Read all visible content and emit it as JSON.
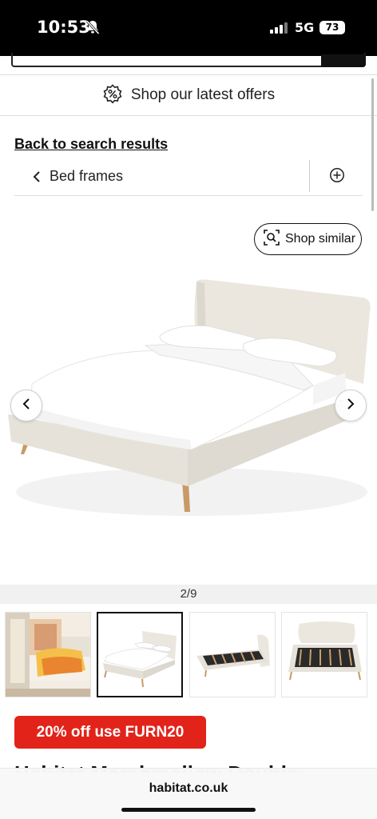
{
  "status_bar": {
    "time": "10:53",
    "network": "5G",
    "battery": "73"
  },
  "offers": {
    "label": "Shop our latest offers",
    "icon": "percent-badge-icon"
  },
  "navigation": {
    "back_link": "Back to search results",
    "breadcrumb": "Bed frames"
  },
  "shop_similar": {
    "label": "Shop similar",
    "icon": "visual-search-icon"
  },
  "gallery": {
    "counter": "2/9",
    "thumbnails": [
      {
        "name": "thumbnail-lifestyle",
        "active": false
      },
      {
        "name": "thumbnail-bed-front",
        "active": true
      },
      {
        "name": "thumbnail-bed-frame-slats",
        "active": false
      },
      {
        "name": "thumbnail-bed-frame-back",
        "active": false
      }
    ]
  },
  "product": {
    "promo": "20% off use FURN20",
    "title": "Habitat Marshmallow Double"
  },
  "browser": {
    "domain": "habitat.co.uk"
  },
  "colors": {
    "promo_red": "#e2231a",
    "bed_fabric": "#ece9e1",
    "bed_linen": "#ffffff",
    "wood_legs": "#c99a66"
  }
}
